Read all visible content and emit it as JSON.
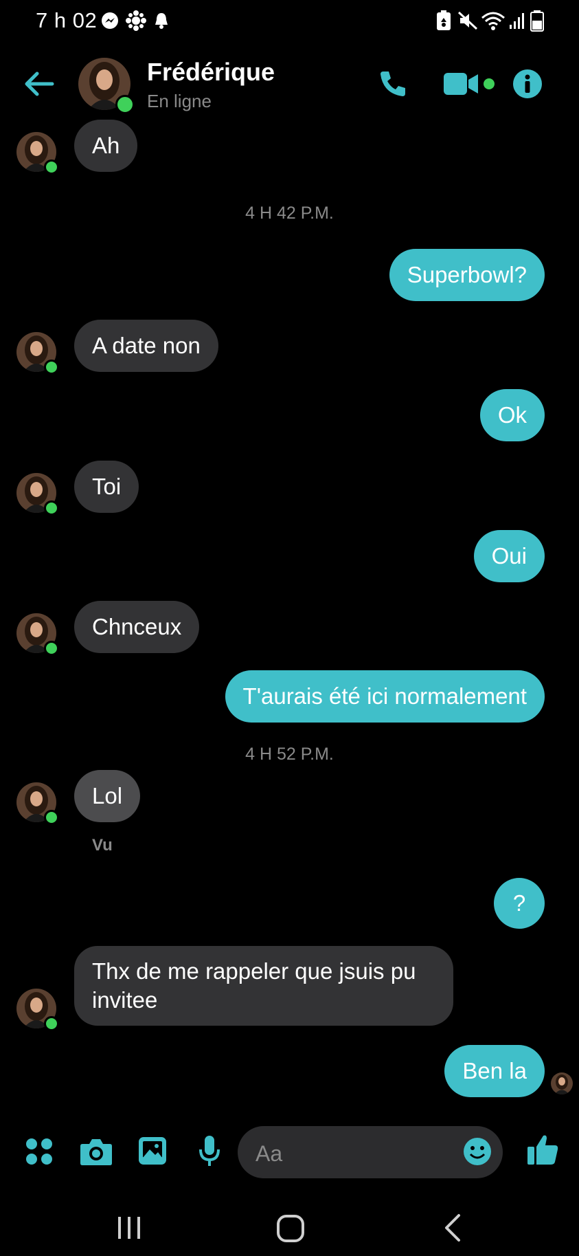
{
  "status_bar": {
    "time": "7 h 02",
    "icons": [
      "messenger-icon",
      "cbc-icon",
      "notification-bell-icon",
      "battery-saver-icon",
      "mute-icon",
      "wifi-icon",
      "signal-icon",
      "battery-icon"
    ]
  },
  "header": {
    "back_icon": "arrow-left-icon",
    "contact_name": "Frédérique",
    "contact_status": "En ligne",
    "actions": [
      "phone-icon",
      "video-icon",
      "info-icon"
    ]
  },
  "messages": [
    {
      "side": "in",
      "text": "Ah"
    },
    {
      "type": "timestamp",
      "text": "4 H 42 P.M."
    },
    {
      "side": "out",
      "text": "Superbowl?"
    },
    {
      "side": "in",
      "text": "A date non"
    },
    {
      "side": "out",
      "text": "Ok"
    },
    {
      "side": "in",
      "text": "Toi"
    },
    {
      "side": "out",
      "text": "Oui"
    },
    {
      "side": "in",
      "text": "Chnceux"
    },
    {
      "side": "out",
      "text": "T'aurais été ici normalement"
    },
    {
      "type": "timestamp",
      "text": "4 H 52 P.M."
    },
    {
      "side": "in",
      "text": "Lol"
    },
    {
      "type": "seen",
      "text": "Vu"
    },
    {
      "side": "out",
      "text": "?"
    },
    {
      "side": "in",
      "text_line1": "Thx de me rappeler que jsuis pu",
      "text_line2": "invitee"
    },
    {
      "side": "out",
      "text": "Ben la"
    }
  ],
  "composer": {
    "placeholder": "Aa",
    "tools": [
      "menu-dots-icon",
      "camera-icon",
      "gallery-icon",
      "microphone-icon"
    ],
    "emoji_icon": "emoji-icon",
    "like_icon": "thumbs-up-icon"
  },
  "colors": {
    "accent": "#40bfc9",
    "incoming_bubble": "#333335",
    "online": "#3fd15a",
    "background": "#000000"
  }
}
